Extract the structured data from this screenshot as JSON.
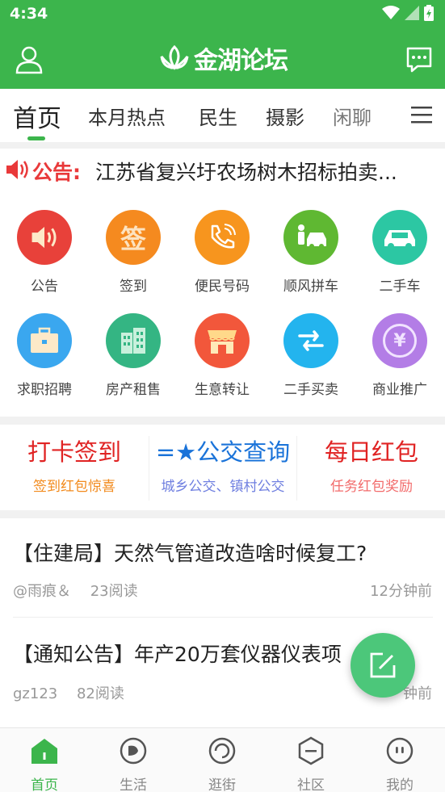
{
  "status_bar": {
    "time": "4:34"
  },
  "header": {
    "logo_text": "金湖论坛"
  },
  "tabs": [
    {
      "label": "首页",
      "active": true
    },
    {
      "label": "本月热点"
    },
    {
      "label": "民生"
    },
    {
      "label": "摄影"
    },
    {
      "label": "闲聊"
    }
  ],
  "notice": {
    "label": "公告:",
    "text": "江苏省复兴圩农场树木招标拍卖..."
  },
  "grid": [
    {
      "label": "公告",
      "icon": "speaker-icon",
      "color": "#e8413a"
    },
    {
      "label": "签到",
      "icon": "signin-icon",
      "color": "#f58a1f",
      "glyph": "签"
    },
    {
      "label": "便民号码",
      "icon": "phone-icon",
      "color": "#f7951e"
    },
    {
      "label": "顺风拼车",
      "icon": "carpool-icon",
      "color": "#5fb832"
    },
    {
      "label": "二手车",
      "icon": "car-icon",
      "color": "#2cc7a3"
    },
    {
      "label": "求职招聘",
      "icon": "briefcase-icon",
      "color": "#3aa7ef"
    },
    {
      "label": "房产租售",
      "icon": "building-icon",
      "color": "#34b583"
    },
    {
      "label": "生意转让",
      "icon": "shop-icon",
      "color": "#f2573b"
    },
    {
      "label": "二手买卖",
      "icon": "exchange-icon",
      "color": "#23b4ee"
    },
    {
      "label": "商业推广",
      "icon": "yen-icon",
      "color": "#b37de6",
      "glyph": "¥"
    }
  ],
  "promos": [
    {
      "title": "打卡签到",
      "subtitle": "签到红包惊喜",
      "title_color": "#e02323",
      "sub_color": "#f28a1c"
    },
    {
      "title": "=★公交查询",
      "subtitle": "城乡公交、镇村公交",
      "title_color": "#1a73d9",
      "sub_color": "#6f7fe0"
    },
    {
      "title": "每日红包",
      "subtitle": "任务红包奖励",
      "title_color": "#e02323",
      "sub_color": "#f26b6b"
    }
  ],
  "posts": [
    {
      "title": "【住建局】天然气管道改造啥时候复工?",
      "author": "@雨痕＆",
      "reads": "23阅读",
      "time": "12分钟前"
    },
    {
      "title": "【通知公告】年产20万套仪器仪表项",
      "author": "gz123",
      "reads": "82阅读",
      "time": "钟前"
    }
  ],
  "bottom_nav": [
    {
      "label": "首页",
      "active": true
    },
    {
      "label": "生活"
    },
    {
      "label": "逛街"
    },
    {
      "label": "社区"
    },
    {
      "label": "我的"
    }
  ],
  "colors": {
    "brand": "#3cb54c",
    "notice": "#e9393a"
  }
}
